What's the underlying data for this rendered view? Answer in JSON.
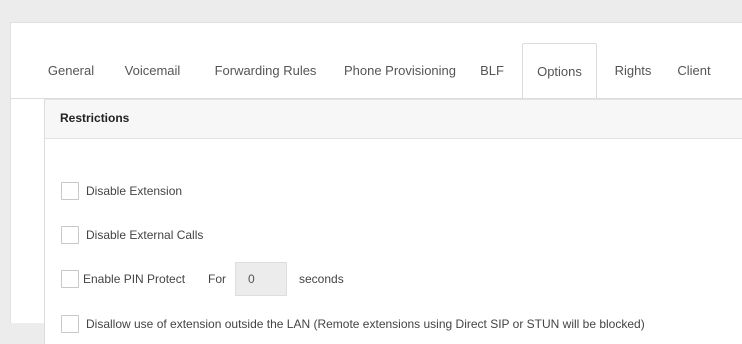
{
  "tabs": [
    {
      "label": "General"
    },
    {
      "label": "Voicemail"
    },
    {
      "label": "Forwarding Rules"
    },
    {
      "label": "Phone Provisioning"
    },
    {
      "label": "BLF"
    },
    {
      "label": "Options",
      "active": true
    },
    {
      "label": "Rights"
    },
    {
      "label": "Client"
    }
  ],
  "restrictions": {
    "title": "Restrictions",
    "disable_extension": {
      "label": "Disable Extension",
      "checked": false
    },
    "disable_external_calls": {
      "label": "Disable External Calls",
      "checked": false
    },
    "pin_protect": {
      "label": "Enable PIN Protect",
      "checked": false,
      "for_label": "For",
      "value": "0",
      "seconds_label": "seconds"
    },
    "disallow_outside_lan": {
      "label": "Disallow use of extension outside the LAN (Remote extensions using Direct SIP or STUN will be blocked)",
      "checked": false
    }
  }
}
